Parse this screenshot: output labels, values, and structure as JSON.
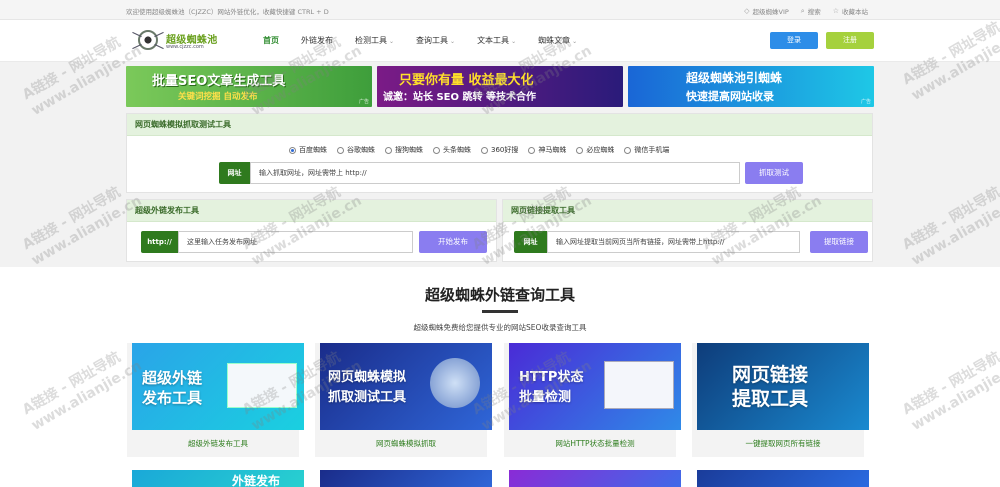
{
  "topbar": {
    "welcome": "欢迎使用超级蜘蛛池（CJZZC）网站外链优化，收藏快捷键 CTRL + D",
    "vip": "超级蜘蛛VIP",
    "search": "搜索",
    "bookmark": "收藏本站"
  },
  "header": {
    "logo_title": "超级蜘蛛池",
    "logo_url": "www.cjzzc.com",
    "nav": [
      {
        "label": "首页"
      },
      {
        "label": "外链发布"
      },
      {
        "label": "检测工具"
      },
      {
        "label": "查询工具"
      },
      {
        "label": "文本工具"
      },
      {
        "label": "蜘蛛文章"
      }
    ],
    "login": "登录",
    "register": "注册"
  },
  "banners": [
    {
      "line1": "批量SEO文章生成工具",
      "line2": "关键词挖掘   自动发布",
      "ad": "广告"
    },
    {
      "line1": "只要你有量 收益最大化",
      "line2": "诚邀：站长 SEO 跳转 等技术合作",
      "ad": ""
    },
    {
      "line1": "超级蜘蛛池引蜘蛛",
      "line2": "快速提高网站收录",
      "ad": "广告"
    }
  ],
  "spider_test": {
    "title": "网页蜘蛛模拟抓取测试工具",
    "options": [
      "百度蜘蛛",
      "谷歌蜘蛛",
      "搜狗蜘蛛",
      "头条蜘蛛",
      "360好搜",
      "神马蜘蛛",
      "必应蜘蛛",
      "微信手机端"
    ],
    "selected": "百度蜘蛛",
    "url_tag": "网址",
    "url_placeholder": "输入抓取网址，网址需带上 http://",
    "button": "抓取测试"
  },
  "link_publish": {
    "title": "超级外链发布工具",
    "tag": "http://",
    "placeholder": "这里输入任务发布网址",
    "button": "开始发布"
  },
  "link_extract": {
    "title": "网页链接提取工具",
    "tag": "网址",
    "placeholder": "输入网址提取当前网页当所有链接，网址需带上http://",
    "button": "提取链接"
  },
  "section": {
    "title": "超级蜘蛛外链查询工具",
    "subtitle": "超级蜘蛛免费给您提供专业的网站SEO收录查询工具"
  },
  "cards": [
    {
      "image_text": "超级外链\n发布工具",
      "caption": "超级外链发布工具"
    },
    {
      "image_text": "网页蜘蛛模拟\n抓取测试工具",
      "caption": "网页蜘蛛模拟抓取"
    },
    {
      "image_text": "HTTP状态\n批量检测",
      "caption": "网站HTTP状态批量检测"
    },
    {
      "image_text": "网页链接\n提取工具",
      "caption": "一键提取网页所有链接"
    }
  ],
  "cards_row2_partial_text": "外链发布",
  "watermark": "A链接 - 网址导航\nwww.alianjie.cn",
  "colors": {
    "accent_green": "#2e8b2e",
    "login_blue": "#2d8de8",
    "register_green": "#a5d13d",
    "button_purple": "#8a7df0",
    "tag_green": "#2f7a1e",
    "panel_head": "#e4f2de"
  },
  "icons": [
    "vip-diamond-icon",
    "search-icon",
    "star-icon",
    "radio-icon",
    "spider-logo-icon"
  ]
}
